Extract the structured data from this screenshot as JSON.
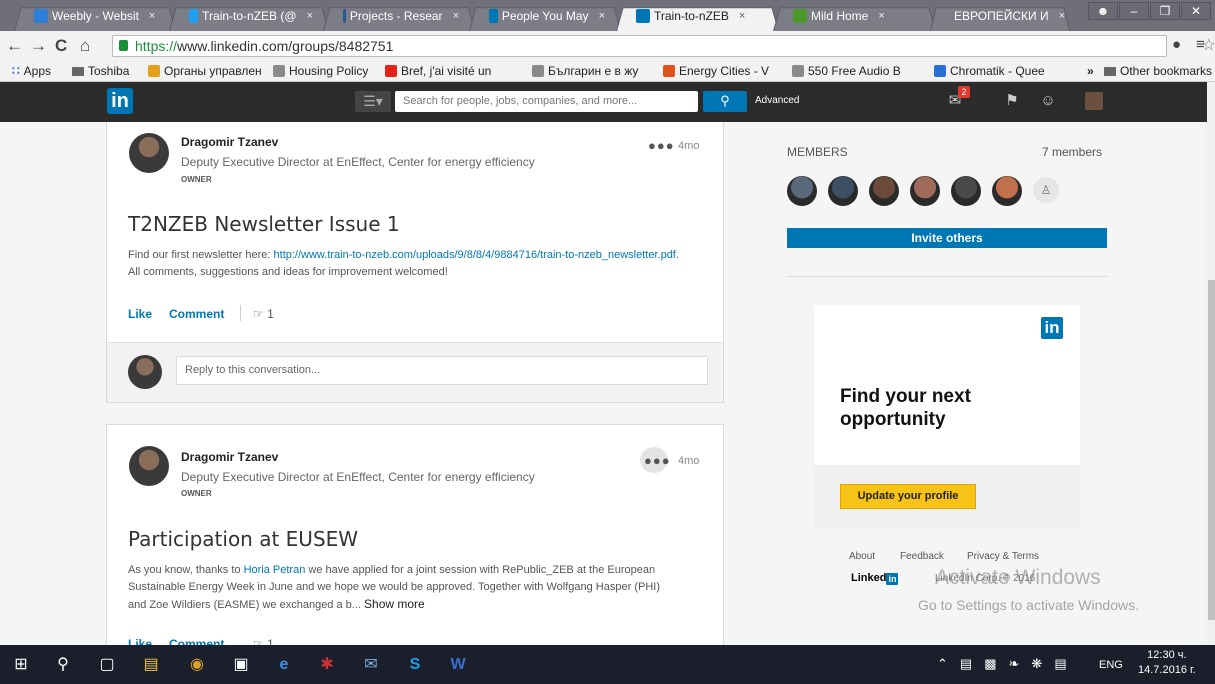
{
  "browser": {
    "tabs": [
      {
        "label": "Weebly - Websit",
        "favicon": "weebly-icon",
        "color": "#2d7ed6"
      },
      {
        "label": "Train-to-nZEB (@",
        "favicon": "twitter-icon",
        "color": "#1da1f2"
      },
      {
        "label": "Projects - Resear",
        "favicon": "chart-icon",
        "color": "#2b5797"
      },
      {
        "label": "People You May",
        "favicon": "linkedin-icon",
        "color": "#0077b5"
      },
      {
        "label": "Train-to-nZEB",
        "favicon": "linkedin-icon",
        "color": "#0077b5",
        "active": true
      },
      {
        "label": "Mild Home",
        "favicon": "leaf-icon",
        "color": "#4a9a2b"
      },
      {
        "label": "ЕВРОПЕЙСКИ И",
        "favicon": "doc-icon",
        "color": "#999999"
      }
    ],
    "url_scheme": "https://",
    "url_rest": "www.linkedin.com/groups/8482751",
    "bookmarks": [
      {
        "label": "Apps",
        "icon": "apps-grid-icon"
      },
      {
        "label": "Toshiba",
        "icon": "folder-icon"
      },
      {
        "label": "Органы управлен",
        "icon": "star-icon"
      },
      {
        "label": "Housing Policy",
        "icon": "page-icon"
      },
      {
        "label": "Bref, j'ai visité un",
        "icon": "youtube-icon"
      },
      {
        "label": "Българин е в жу",
        "icon": "page-icon"
      },
      {
        "label": "Energy Cities - V",
        "icon": "circle-icon"
      },
      {
        "label": "550 Free Audio B",
        "icon": "page-icon"
      },
      {
        "label": "Chromatik - Quee",
        "icon": "c-icon"
      },
      {
        "label": "»",
        "icon": "chevron-icon"
      },
      {
        "label": "Other bookmarks",
        "icon": "folder-icon"
      }
    ]
  },
  "linkedin": {
    "logo": "in",
    "search_placeholder": "Search for people, jobs, companies, and more...",
    "advanced": "Advanced",
    "message_badge": "2"
  },
  "posts": [
    {
      "author": "Dragomir Tzanev",
      "headline": "Deputy Executive Director at EnEffect, Center for energy efficiency",
      "role": "OWNER",
      "age": "4mo",
      "title": "T2NZEB Newsletter Issue 1",
      "body_before": "Find our first newsletter here: ",
      "body_link": "http://www.train-to-nzeb.com/uploads/9/8/8/4/9884716/train-to-nzeb_newsletter.pdf",
      "body_after": ". All comments, suggestions and ideas for improvement welcomed!",
      "like": "Like",
      "comment": "Comment",
      "like_count": "1",
      "reply_placeholder": "Reply to this conversation..."
    },
    {
      "author": "Dragomir Tzanev",
      "headline": "Deputy Executive Director at EnEffect, Center for energy efficiency",
      "role": "OWNER",
      "age": "4mo",
      "title": "Participation at EUSEW",
      "body_before": "As you know, thanks to ",
      "body_link": "Horia Petran",
      "body_after": " we have applied for a joint session with RePublic_ZEB at the European Sustainable Energy Week in June and we hope we would be approved. Together with Wolfgang Hasper (PHI) and Zoe Wildiers (EASME) we exchanged a b...",
      "show_more": "Show more",
      "like": "Like",
      "comment": "Comment",
      "like_count": "1"
    }
  ],
  "sidebar": {
    "members_label": "MEMBERS",
    "members_count": "7 members",
    "member_avatar_colors": [
      "#5a6a7a",
      "#3d4f63",
      "#6b4a3a",
      "#a06a5a",
      "#4a4a4a",
      "#c0704a"
    ],
    "invite": "Invite others",
    "ad_logo": "in",
    "ad_headline": "Find your next opportunity",
    "ad_button": "Update your profile",
    "footer_links": [
      "About",
      "Feedback",
      "Privacy & Terms"
    ],
    "footer_brand": "Linked",
    "footer_brand_in": "in",
    "copyright": "LinkedIn Corp. © 2016"
  },
  "watermark": {
    "line1": "Activate Windows",
    "line2": "Go to Settings to activate Windows."
  },
  "taskbar": {
    "lang": "ENG",
    "time": "12:30 ч.",
    "date": "14.7.2016 г."
  }
}
